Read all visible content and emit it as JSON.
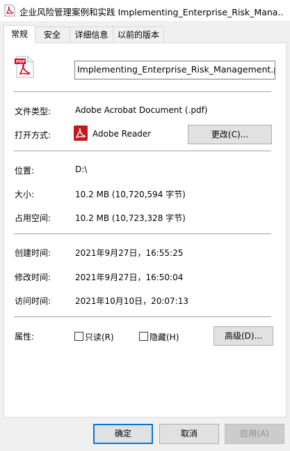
{
  "window": {
    "title": "企业风险管理案例和实践 Implementing_Enterprise_Risk_Mana..."
  },
  "tabs": [
    {
      "label": "常规"
    },
    {
      "label": "安全"
    },
    {
      "label": "详细信息"
    },
    {
      "label": "以前的版本"
    }
  ],
  "general": {
    "filename": "Implementing_Enterprise_Risk_Management.pdf",
    "file_type_label": "文件类型:",
    "file_type_value": "Adobe Acrobat Document (.pdf)",
    "opens_with_label": "打开方式:",
    "opens_with_value": "Adobe Reader",
    "change_button": "更改(C)...",
    "location_label": "位置:",
    "location_value": "D:\\",
    "size_label": "大小:",
    "size_value": "10.2 MB (10,720,594 字节)",
    "size_on_disk_label": "占用空间:",
    "size_on_disk_value": "10.2 MB (10,723,328 字节)",
    "created_label": "创建时间:",
    "created_value": "2021年9月27日，16:55:25",
    "modified_label": "修改时间:",
    "modified_value": "2021年9月27日，16:50:04",
    "accessed_label": "访问时间:",
    "accessed_value": "2021年10月10日，20:07:13",
    "attributes_label": "属性:",
    "readonly_label": "只读(R)",
    "hidden_label": "隐藏(H)",
    "advanced_button": "高级(D)..."
  },
  "footer": {
    "ok_button": "确定",
    "cancel_button": "取消",
    "apply_button": "应用(A)"
  },
  "colors": {
    "accent": "#0078d7",
    "pdf_red": "#d0021b"
  }
}
